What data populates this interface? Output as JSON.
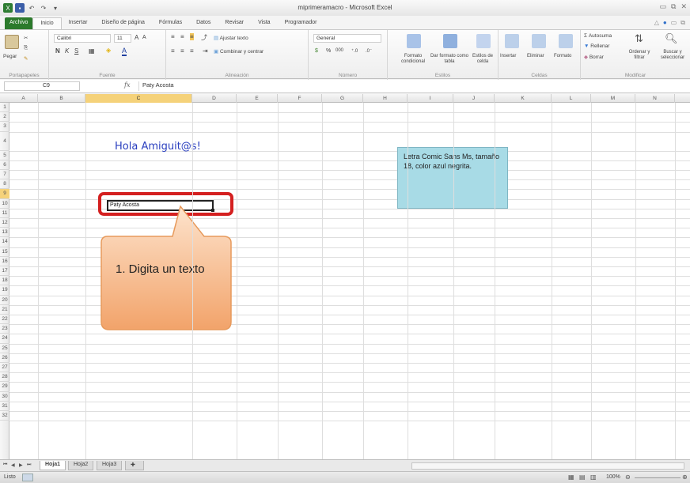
{
  "window": {
    "title": "miprimeramacro - Microsoft Excel"
  },
  "tabs": [
    "Archivo",
    "Inicio",
    "Insertar",
    "Diseño de página",
    "Fórmulas",
    "Datos",
    "Revisar",
    "Vista",
    "Programador"
  ],
  "ribbon": {
    "portapapeles": {
      "label": "Portapapeles",
      "pegar": "Pegar"
    },
    "fuente": {
      "label": "Fuente",
      "font": "Calibri",
      "size": "11"
    },
    "alineacion": {
      "label": "Alineación",
      "wrap": "Ajustar texto",
      "merge": "Combinar y centrar"
    },
    "numero": {
      "label": "Número",
      "format": "General"
    },
    "estilos": {
      "label": "Estilos",
      "cond": "Formato condicional",
      "table": "Dar formato como tabla",
      "cell": "Estilos de celda"
    },
    "celdas": {
      "label": "Celdas",
      "insert": "Insertar",
      "delete": "Eliminar",
      "format": "Formato"
    },
    "modificar": {
      "label": "Modificar",
      "autosum": "Autosuma",
      "fill": "Rellenar",
      "clear": "Borrar",
      "sort": "Ordenar y filtrar",
      "find": "Buscar y seleccionar"
    }
  },
  "formula_bar": {
    "name_box": "C9",
    "fx": "fx",
    "content": "Paty Acosta"
  },
  "columns": [
    "A",
    "B",
    "C",
    "D",
    "E",
    "F",
    "G",
    "H",
    "I",
    "J",
    "K",
    "L",
    "M",
    "N"
  ],
  "rows": [
    "1",
    "2",
    "3",
    "4",
    "5",
    "6",
    "7",
    "8",
    "9",
    "10",
    "11",
    "12",
    "13",
    "14",
    "15",
    "16",
    "17",
    "18",
    "19",
    "20",
    "21",
    "22",
    "23",
    "24",
    "25",
    "26",
    "27",
    "28",
    "29",
    "30",
    "31",
    "32"
  ],
  "cells": {
    "c4": "Hola Amiguit@s!",
    "c9": "Paty Acosta"
  },
  "note": "Letra Comic Sans Ms, tamaño 18, color azul negrita.",
  "callout": "1. Digita un texto",
  "sheets": [
    "Hoja1",
    "Hoja2",
    "Hoja3"
  ],
  "status": {
    "mode": "Listo",
    "zoom": "100%"
  }
}
